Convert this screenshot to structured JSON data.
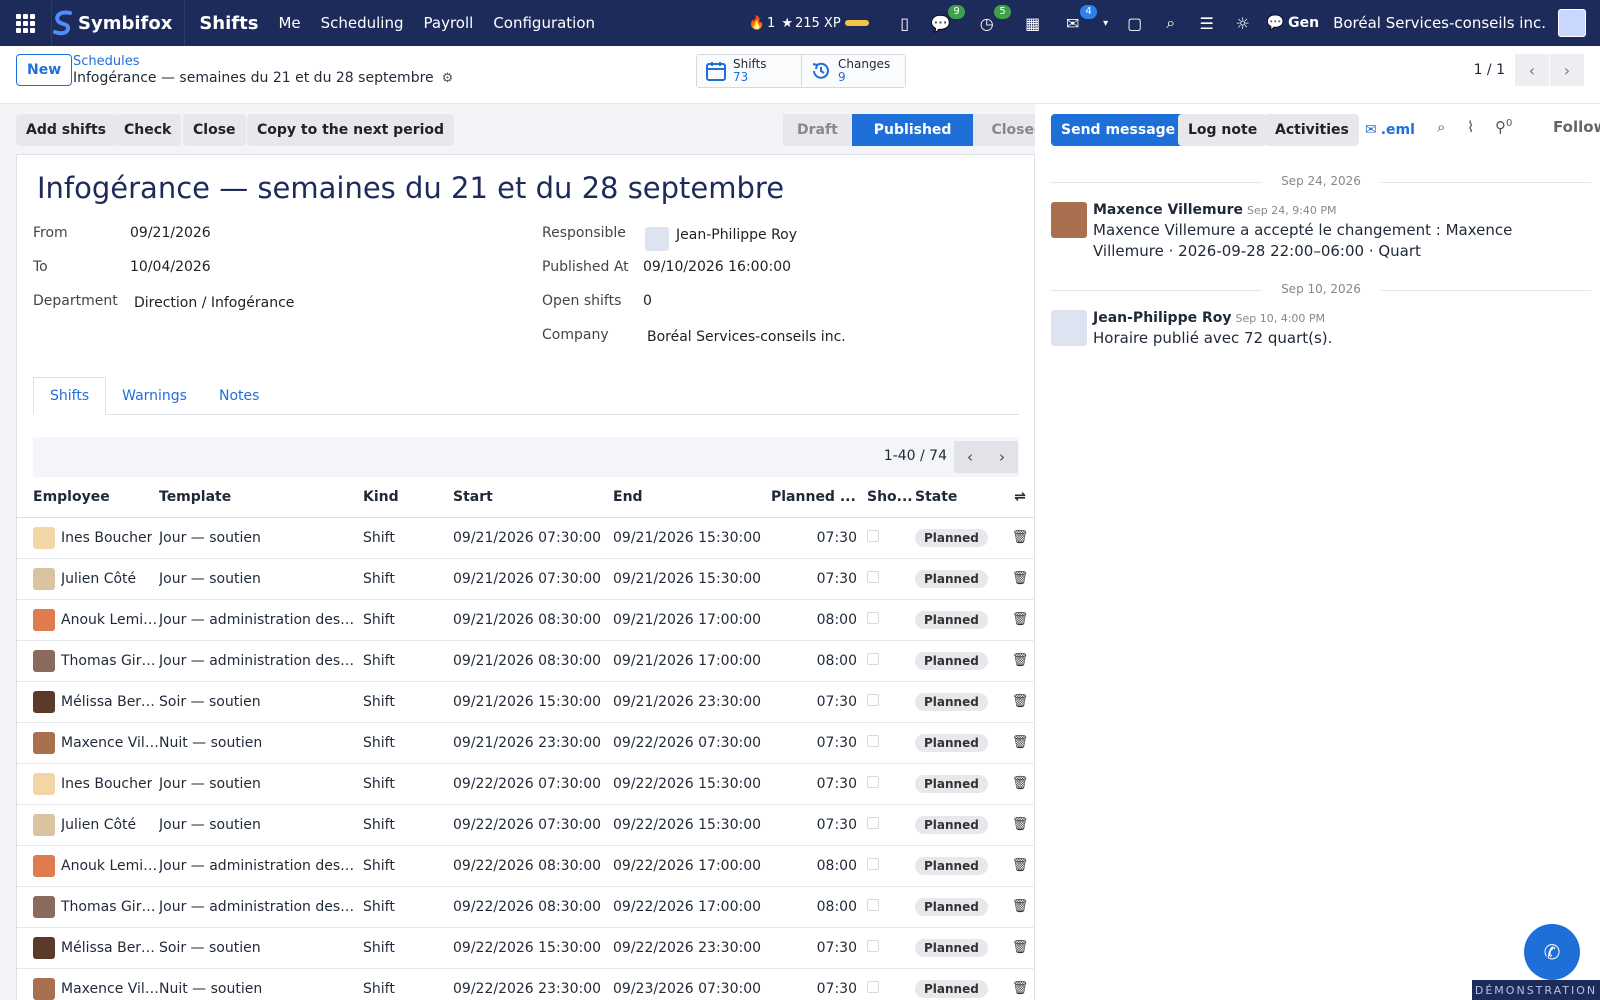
{
  "navbar": {
    "brand": "Symbifox",
    "app": "Shifts",
    "menu": [
      "Me",
      "Scheduling",
      "Payroll",
      "Configuration"
    ],
    "streak": "1",
    "xp": "215 XP",
    "messages_badge": "9",
    "activities_badge": "5",
    "notifications_badge": "4",
    "gen": "Gen",
    "company": "Boréal Services-conseils inc."
  },
  "control": {
    "new_label": "New",
    "breadcrumb_parent": "Schedules",
    "breadcrumb_current": "Infogérance — semaines du 21 et du 28 septembre",
    "smart_buttons": [
      {
        "label": "Shifts",
        "value": "73",
        "icon": "calendar-icon"
      },
      {
        "label": "Changes",
        "value": "9",
        "icon": "history-icon"
      }
    ],
    "pager": "1 / 1"
  },
  "actions": {
    "add_shifts": "Add shifts",
    "check": "Check",
    "close": "Close",
    "copy": "Copy to the next period"
  },
  "statusbar": {
    "stages": [
      "Draft",
      "Published",
      "Closed"
    ],
    "current": "Published"
  },
  "record": {
    "title": "Infogérance — semaines du 21 et du 28 septembre",
    "from_label": "From",
    "from": "09/21/2026",
    "to_label": "To",
    "to": "10/04/2026",
    "department_label": "Department",
    "department": "Direction / Infogérance",
    "responsible_label": "Responsible",
    "responsible": "Jean-Philippe Roy",
    "published_at_label": "Published At",
    "published_at": "09/10/2026 16:00:00",
    "open_shifts_label": "Open shifts",
    "open_shifts": "0",
    "company_label": "Company",
    "company": "Boréal Services-conseils inc."
  },
  "tabs": [
    "Shifts",
    "Warnings",
    "Notes"
  ],
  "list": {
    "pager": "1-40 / 74",
    "columns": [
      "Employee",
      "Template",
      "Kind",
      "Start",
      "End",
      "Planned ...",
      "Sho...",
      "State"
    ],
    "rows": [
      {
        "employee": "Ines Boucher",
        "template": "Jour — soutien",
        "kind": "Shift",
        "start": "09/21/2026 07:30:00",
        "end": "09/21/2026 15:30:00",
        "planned": "07:30",
        "state": "Planned",
        "avatar": "#f3d6a8"
      },
      {
        "employee": "Julien Côté",
        "template": "Jour — soutien",
        "kind": "Shift",
        "start": "09/21/2026 07:30:00",
        "end": "09/21/2026 15:30:00",
        "planned": "07:30",
        "state": "Planned",
        "avatar": "#d9c3a0"
      },
      {
        "employee": "Anouk Lemieux",
        "template": "Jour — administration des systèmes",
        "kind": "Shift",
        "start": "09/21/2026 08:30:00",
        "end": "09/21/2026 17:00:00",
        "planned": "08:00",
        "state": "Planned",
        "avatar": "#e07a4f"
      },
      {
        "employee": "Thomas Girard",
        "template": "Jour — administration des systèmes",
        "kind": "Shift",
        "start": "09/21/2026 08:30:00",
        "end": "09/21/2026 17:00:00",
        "planned": "08:00",
        "state": "Planned",
        "avatar": "#8a6a5c"
      },
      {
        "employee": "Mélissa Bernier",
        "template": "Soir — soutien",
        "kind": "Shift",
        "start": "09/21/2026 15:30:00",
        "end": "09/21/2026 23:30:00",
        "planned": "07:30",
        "state": "Planned",
        "avatar": "#5b3a2a"
      },
      {
        "employee": "Maxence Villemure",
        "template": "Nuit — soutien",
        "kind": "Shift",
        "start": "09/21/2026 23:30:00",
        "end": "09/22/2026 07:30:00",
        "planned": "07:30",
        "state": "Planned",
        "avatar": "#a8704e"
      },
      {
        "employee": "Ines Boucher",
        "template": "Jour — soutien",
        "kind": "Shift",
        "start": "09/22/2026 07:30:00",
        "end": "09/22/2026 15:30:00",
        "planned": "07:30",
        "state": "Planned",
        "avatar": "#f3d6a8"
      },
      {
        "employee": "Julien Côté",
        "template": "Jour — soutien",
        "kind": "Shift",
        "start": "09/22/2026 07:30:00",
        "end": "09/22/2026 15:30:00",
        "planned": "07:30",
        "state": "Planned",
        "avatar": "#d9c3a0"
      },
      {
        "employee": "Anouk Lemieux",
        "template": "Jour — administration des systèmes",
        "kind": "Shift",
        "start": "09/22/2026 08:30:00",
        "end": "09/22/2026 17:00:00",
        "planned": "08:00",
        "state": "Planned",
        "avatar": "#e07a4f"
      },
      {
        "employee": "Thomas Girard",
        "template": "Jour — administration des systèmes",
        "kind": "Shift",
        "start": "09/22/2026 08:30:00",
        "end": "09/22/2026 17:00:00",
        "planned": "08:00",
        "state": "Planned",
        "avatar": "#8a6a5c"
      },
      {
        "employee": "Mélissa Bernier",
        "template": "Soir — soutien",
        "kind": "Shift",
        "start": "09/22/2026 15:30:00",
        "end": "09/22/2026 23:30:00",
        "planned": "07:30",
        "state": "Planned",
        "avatar": "#5b3a2a"
      },
      {
        "employee": "Maxence Villemure",
        "template": "Nuit — soutien",
        "kind": "Shift",
        "start": "09/22/2026 23:30:00",
        "end": "09/23/2026 07:30:00",
        "planned": "07:30",
        "state": "Planned",
        "avatar": "#a8704e"
      }
    ]
  },
  "chatter": {
    "send_message": "Send message",
    "log_note": "Log note",
    "activities": "Activities",
    "eml": ".eml",
    "followers_count": "0",
    "follow": "Follow",
    "messages": [
      {
        "date": "Sep 24, 2026",
        "author": "Maxence Villemure",
        "time": "Sep 24, 9:40 PM",
        "body": "Maxence Villemure a accepté le changement : Maxence Villemure · 2026-09-28 22:00–06:00 · Quart",
        "avatar": "#a8704e"
      },
      {
        "date": "Sep 10, 2026",
        "author": "Jean-Philippe Roy",
        "time": "Sep 10, 4:00 PM",
        "body": "Horaire publié avec 72 quart(s).",
        "avatar": "#dde3f0"
      }
    ]
  },
  "demo_banner": "DÉMONSTRATION"
}
